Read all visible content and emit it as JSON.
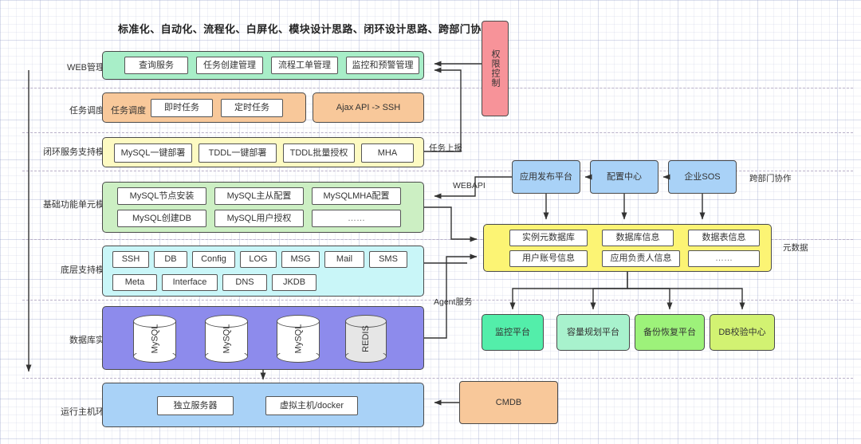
{
  "title": "标准化、自动化、流程化、白屏化、模块设计思路、闭环设计思路、跨部门协作",
  "layers": [
    {
      "label": "WEB管理层"
    },
    {
      "label": "任务调度层"
    },
    {
      "label": "闭环服务支持模块"
    },
    {
      "label": "基础功能单元模块"
    },
    {
      "label": "底层支持模块"
    },
    {
      "label": "数据库实例"
    },
    {
      "label": "运行主机环境"
    }
  ],
  "web_layer": {
    "color": "#a8eec8",
    "items": [
      "查询服务",
      "任务创建管理",
      "流程工单管理",
      "监控和预警管理"
    ]
  },
  "schedule_layer": {
    "color": "#f8c89a",
    "group_label": "任务调度",
    "items": [
      "即时任务",
      "定时任务"
    ],
    "right_panel": "Ajax API -> SSH"
  },
  "closed_loop_layer": {
    "color": "#fdfac2",
    "items": [
      "MySQL一键部署",
      "TDDL一键部署",
      "TDDL批量授权",
      "MHA"
    ]
  },
  "base_unit_layer": {
    "color": "#ccefc3",
    "row1": [
      "MySQL节点安装",
      "MySQL主从配置",
      "MySQLMHA配置"
    ],
    "row2": [
      "MySQL创建DB",
      "MySQL用户授权",
      "……"
    ]
  },
  "support_layer": {
    "color": "#c9f6f8",
    "row1": [
      "SSH",
      "DB",
      "Config",
      "LOG",
      "MSG",
      "Mail",
      "SMS"
    ],
    "row2": [
      "Meta",
      "Interface",
      "DNS",
      "JKDB"
    ]
  },
  "db_layer": {
    "color": "#8d8bec",
    "instances": [
      {
        "label": "MySQL",
        "fill": "#ffffff"
      },
      {
        "label": "MySQL",
        "fill": "#ffffff"
      },
      {
        "label": "MySQL",
        "fill": "#ffffff"
      },
      {
        "label": "REDIS",
        "fill": "#e6e6e6"
      }
    ]
  },
  "host_layer": {
    "color": "#a9d2f7",
    "items": [
      "独立服务器",
      "虚拟主机/docker"
    ]
  },
  "cmdb": {
    "label": "CMDB",
    "color": "#f8c89a"
  },
  "auth_box": {
    "label": "权限控制",
    "color": "#f79399"
  },
  "cross_dept": {
    "side_label": "跨部门协作",
    "items": [
      {
        "label": "应用发布平台",
        "color": "#a9d2f7"
      },
      {
        "label": "配置中心",
        "color": "#a9d2f7"
      },
      {
        "label": "企业SOS",
        "color": "#a9d2f7"
      }
    ]
  },
  "metadata": {
    "side_label": "元数据",
    "color": "#fcf474",
    "row1": [
      "实例元数据库",
      "数据库信息",
      "数据表信息"
    ],
    "row2": [
      "用户账号信息",
      "应用负责人信息",
      "……"
    ]
  },
  "platforms": [
    {
      "label": "监控平台",
      "color": "#53eeaa"
    },
    {
      "label": "容量规划平台",
      "color": "#a8f2cd"
    },
    {
      "label": "备份恢复平台",
      "color": "#9df27a"
    },
    {
      "label": "DB校验中心",
      "color": "#d2f272"
    }
  ],
  "edges": {
    "task_report": "任务上报",
    "webapi": "WEBAPI",
    "agent": "Agent服务"
  }
}
